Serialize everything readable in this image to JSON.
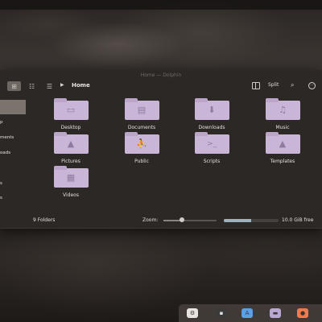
{
  "window": {
    "title": "Home — Dolphin"
  },
  "toolbar": {
    "breadcrumb": "Home",
    "split_label": "Split"
  },
  "sidebar": {
    "items": [
      {
        "label": "p"
      },
      {
        "label": "ments"
      },
      {
        "label": "oads"
      },
      {
        "label": "s"
      },
      {
        "label": "s"
      }
    ]
  },
  "folders": [
    {
      "name": "Desktop",
      "icon": "desktop-icon",
      "glyph": "▭"
    },
    {
      "name": "Documents",
      "icon": "document-icon",
      "glyph": "▤"
    },
    {
      "name": "Downloads",
      "icon": "download-icon",
      "glyph": "⬇"
    },
    {
      "name": "Music",
      "icon": "music-icon",
      "glyph": "♫"
    },
    {
      "name": "Pictures",
      "icon": "picture-icon",
      "glyph": "▲"
    },
    {
      "name": "Public",
      "icon": "people-icon",
      "glyph": "⛹"
    },
    {
      "name": "Scripts",
      "icon": "terminal-icon",
      "glyph": ">_"
    },
    {
      "name": "Templates",
      "icon": "template-icon",
      "glyph": "▲"
    },
    {
      "name": "Videos",
      "icon": "video-icon",
      "glyph": "▦"
    }
  ],
  "status": {
    "folders_count": "9 Folders",
    "zoom_label": "Zoom:",
    "zoom_level": 0.35,
    "free_space": "10.0 GiB free",
    "used_fraction": 0.5
  },
  "dock": {
    "apps": [
      {
        "icon": "settings-icon",
        "color": "#e8e4e1"
      },
      {
        "icon": "terminal-icon",
        "color": "#3a3a3a"
      },
      {
        "icon": "app-store-icon",
        "color": "#5aa0e6"
      },
      {
        "icon": "folder-icon",
        "color": "#b9a6d4"
      },
      {
        "icon": "browser-icon",
        "color": "#f07a4b"
      }
    ]
  }
}
